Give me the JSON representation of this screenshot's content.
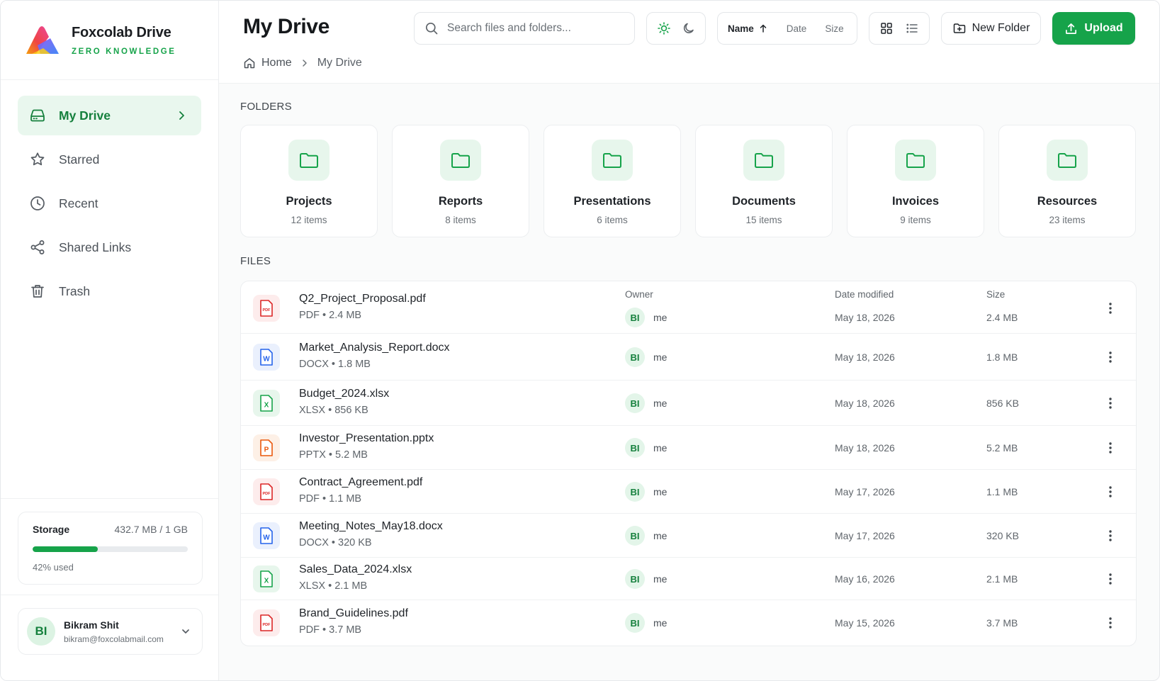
{
  "brand": {
    "name": "Foxcolab Drive",
    "tagline": "ZERO KNOWLEDGE"
  },
  "sidebar": {
    "items": [
      {
        "label": "My Drive",
        "icon": "drive-icon",
        "active": true
      },
      {
        "label": "Starred",
        "icon": "star-icon"
      },
      {
        "label": "Recent",
        "icon": "clock-icon"
      },
      {
        "label": "Shared Links",
        "icon": "share-icon"
      },
      {
        "label": "Trash",
        "icon": "trash-icon"
      }
    ]
  },
  "storage": {
    "label": "Storage",
    "value": "432.7 MB / 1 GB",
    "percent": 42,
    "percent_text": "42% used"
  },
  "user": {
    "initials": "BI",
    "name": "Bikram Shit",
    "email": "bikram@foxcolabmail.com"
  },
  "header": {
    "title": "My Drive",
    "search_placeholder": "Search files and folders...",
    "sort": {
      "name": "Name",
      "date": "Date",
      "size": "Size",
      "active": "Name",
      "direction": "ascending"
    },
    "new_folder": "New Folder",
    "upload": "Upload"
  },
  "breadcrumb": {
    "home": "Home",
    "current": "My Drive"
  },
  "sections": {
    "folders": "FOLDERS",
    "files": "FILES"
  },
  "folders": [
    {
      "name": "Projects",
      "count": "12 items"
    },
    {
      "name": "Reports",
      "count": "8 items"
    },
    {
      "name": "Presentations",
      "count": "6 items"
    },
    {
      "name": "Documents",
      "count": "15 items"
    },
    {
      "name": "Invoices",
      "count": "9 items"
    },
    {
      "name": "Resources",
      "count": "23 items"
    }
  ],
  "files_table": {
    "headers": {
      "owner": "Owner",
      "date": "Date modified",
      "size": "Size"
    },
    "rows": [
      {
        "name": "Q2_Project_Proposal.pdf",
        "meta": "PDF • 2.4 MB",
        "type": "pdf",
        "owner_initials": "BI",
        "owner": "me",
        "date": "May 18, 2026",
        "size": "2.4 MB"
      },
      {
        "name": "Market_Analysis_Report.docx",
        "meta": "DOCX • 1.8 MB",
        "type": "docx",
        "owner_initials": "BI",
        "owner": "me",
        "date": "May 18, 2026",
        "size": "1.8 MB"
      },
      {
        "name": "Budget_2024.xlsx",
        "meta": "XLSX • 856 KB",
        "type": "xlsx",
        "owner_initials": "BI",
        "owner": "me",
        "date": "May 18, 2026",
        "size": "856 KB"
      },
      {
        "name": "Investor_Presentation.pptx",
        "meta": "PPTX • 5.2 MB",
        "type": "pptx",
        "owner_initials": "BI",
        "owner": "me",
        "date": "May 18, 2026",
        "size": "5.2 MB"
      },
      {
        "name": "Contract_Agreement.pdf",
        "meta": "PDF • 1.1 MB",
        "type": "pdf",
        "owner_initials": "BI",
        "owner": "me",
        "date": "May 17, 2026",
        "size": "1.1 MB"
      },
      {
        "name": "Meeting_Notes_May18.docx",
        "meta": "DOCX • 320 KB",
        "type": "docx",
        "owner_initials": "BI",
        "owner": "me",
        "date": "May 17, 2026",
        "size": "320 KB"
      },
      {
        "name": "Sales_Data_2024.xlsx",
        "meta": "XLSX • 2.1 MB",
        "type": "xlsx",
        "owner_initials": "BI",
        "owner": "me",
        "date": "May 16, 2026",
        "size": "2.1 MB"
      },
      {
        "name": "Brand_Guidelines.pdf",
        "meta": "PDF • 3.7 MB",
        "type": "pdf",
        "owner_initials": "BI",
        "owner": "me",
        "date": "May 15, 2026",
        "size": "3.7 MB"
      }
    ]
  },
  "colors": {
    "accent": "#16a34a",
    "accent_soft": "#e9f7ee",
    "pdf": "#dc2626",
    "docx": "#2563eb",
    "xlsx": "#16a34a",
    "pptx": "#ea580c"
  }
}
